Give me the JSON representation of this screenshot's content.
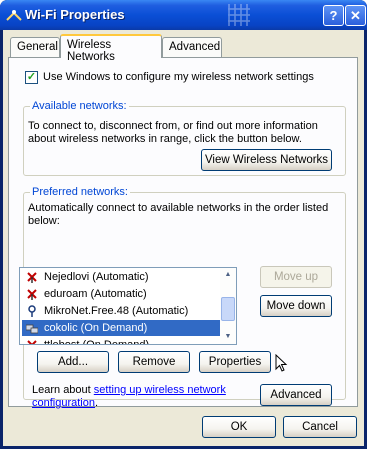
{
  "window": {
    "title": "Wi-Fi Properties",
    "help_button": "?",
    "close_button": "✕"
  },
  "tabs": [
    {
      "label": "General"
    },
    {
      "label": "Wireless Networks",
      "active": true
    },
    {
      "label": "Advanced"
    }
  ],
  "use_windows_checkbox": {
    "checked": true,
    "label": "Use Windows to configure my wireless network settings"
  },
  "available": {
    "title": "Available networks:",
    "description_line1": "To connect to, disconnect from, or find out more information",
    "description_line2": "about wireless networks in range, click the button below.",
    "view_button": "View Wireless Networks"
  },
  "preferred": {
    "title": "Preferred networks:",
    "description_line1": "Automatically connect to available networks in the order listed",
    "description_line2": "below:",
    "networks": [
      {
        "name": "Nejedlovi (Automatic)",
        "icon": "wireless-x-icon"
      },
      {
        "name": "eduroam (Automatic)",
        "icon": "wireless-x-icon"
      },
      {
        "name": "MikroNet.Free.48 (Automatic)",
        "icon": "wireless-antenna-icon"
      },
      {
        "name": "cokolic (On Demand)",
        "icon": "ad-hoc-icon",
        "selected": true
      },
      {
        "name": "ttlebost (On Demand)",
        "icon": "wireless-x-icon"
      }
    ],
    "move_up_button": "Move up",
    "move_down_button": "Move down",
    "add_button": "Add...",
    "remove_button": "Remove",
    "properties_button": "Properties"
  },
  "learn": {
    "prefix": "Learn about ",
    "link_line1": "setting up wireless network",
    "link_line2": "configuration",
    "suffix": ".",
    "advanced_button": "Advanced"
  },
  "footer": {
    "ok_button": "OK",
    "cancel_button": "Cancel"
  },
  "colors": {
    "title_bar": "#0a4fd6",
    "group_title": "#0046d5",
    "selection": "#316ac5",
    "link": "#0000ff"
  }
}
